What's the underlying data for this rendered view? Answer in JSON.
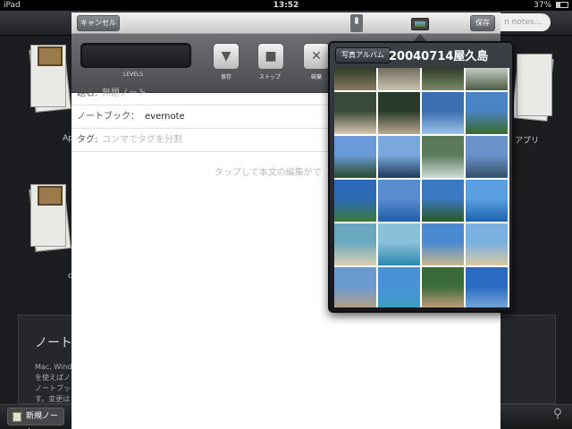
{
  "status_bar": {
    "device": "iPad",
    "time": "13:52",
    "battery": "37%",
    "battery_level": 0.37
  },
  "background": {
    "search_placeholder": "n notes...",
    "notebook_labels": [
      "Ap",
      "アプリ",
      "c"
    ],
    "panel_title": "ノート",
    "panel_lines": [
      "Mac, Windo",
      "を使えばノ",
      "ノートブッ",
      "す。変更は"
    ],
    "new_note_label": "新規ノート"
  },
  "editor": {
    "cancel_label": "キャンセル",
    "save_label": "保存",
    "levels_label": "LEVELS",
    "record_buttons": [
      {
        "label": "保存",
        "glyph": "▼"
      },
      {
        "label": "ストップ",
        "glyph": "■"
      },
      {
        "label": "破棄",
        "glyph": "✕"
      }
    ],
    "title_label": "題名:",
    "title_placeholder": "無題ノート",
    "notebook_label": "ノートブック：",
    "notebook_value": "evernote",
    "tags_label": "タグ:",
    "tags_placeholder": "コンマでタグを分割",
    "body_placeholder": "タップして本文の編集がで"
  },
  "photo_picker": {
    "back_label": "写真アルバム",
    "album_title": "20040714屋久島",
    "photos": [
      {
        "name": "photo-1",
        "colors": [
          "#2d3a24",
          "#8a7a62"
        ]
      },
      {
        "name": "photo-2",
        "colors": [
          "#6d6a5a",
          "#c9c2b0"
        ]
      },
      {
        "name": "photo-3",
        "colors": [
          "#2f3a2a",
          "#7a8a66"
        ]
      },
      {
        "name": "photo-4",
        "colors": [
          "#c8d0c8",
          "#4c5c44"
        ]
      },
      {
        "name": "photo-5",
        "colors": [
          "#3a4a3a",
          "#d8c8b0"
        ]
      },
      {
        "name": "photo-6",
        "colors": [
          "#2a3a2a",
          "#b8a890"
        ]
      },
      {
        "name": "photo-7",
        "colors": [
          "#3a6fb0",
          "#9cc2e8"
        ]
      },
      {
        "name": "photo-8",
        "colors": [
          "#4a84c4",
          "#3a6a2a"
        ]
      },
      {
        "name": "photo-9",
        "colors": [
          "#6a9ad8",
          "#2a4a2a"
        ]
      },
      {
        "name": "photo-10",
        "colors": [
          "#7aa8dc",
          "#1e3a5a"
        ]
      },
      {
        "name": "photo-11",
        "colors": [
          "#5a7a5a",
          "#d0dcd8"
        ]
      },
      {
        "name": "photo-12",
        "colors": [
          "#6a92c8",
          "#34506a"
        ]
      },
      {
        "name": "photo-13",
        "colors": [
          "#2c6ab8",
          "#3a7a3a"
        ]
      },
      {
        "name": "photo-14",
        "colors": [
          "#5a8cd0",
          "#1e5fa8"
        ]
      },
      {
        "name": "photo-15",
        "colors": [
          "#3c78c0",
          "#2a5a2a"
        ]
      },
      {
        "name": "photo-16",
        "colors": [
          "#5aa0e0",
          "#1a62b0"
        ]
      },
      {
        "name": "photo-17",
        "colors": [
          "#6aa8c0",
          "#d8d0b0"
        ]
      },
      {
        "name": "photo-18",
        "colors": [
          "#8ac0d8",
          "#2a8ab0"
        ]
      },
      {
        "name": "photo-19",
        "colors": [
          "#4a88d0",
          "#c8b890"
        ]
      },
      {
        "name": "photo-20",
        "colors": [
          "#7ab0e0",
          "#d8c8a0"
        ]
      },
      {
        "name": "photo-21",
        "colors": [
          "#6a9ad0",
          "#b8a080"
        ]
      },
      {
        "name": "photo-22",
        "colors": [
          "#4a90d8",
          "#3aa0c0"
        ]
      },
      {
        "name": "photo-23",
        "colors": [
          "#3a6a3a",
          "#c8a080"
        ]
      },
      {
        "name": "photo-24",
        "colors": [
          "#2a6ac0",
          "#7aa8d8"
        ]
      }
    ]
  }
}
